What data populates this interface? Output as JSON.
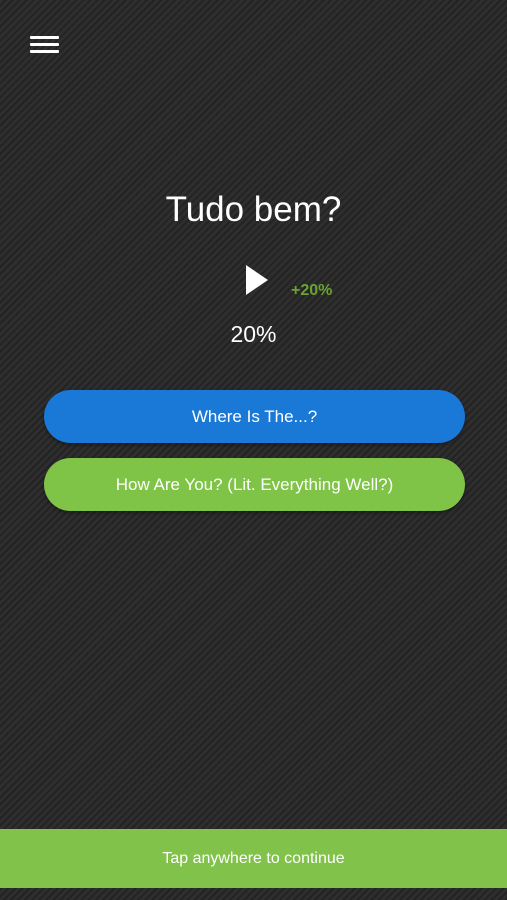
{
  "header": {
    "menu_icon": "hamburger-menu-icon"
  },
  "question": {
    "phrase": "Tudo bem?",
    "play_icon": "play-icon",
    "bonus": "+20%",
    "progress": "20%"
  },
  "answers": [
    {
      "label": "Where Is The...?",
      "color": "#1a78d7"
    },
    {
      "label": "How Are You? (Lit. Everything Well?)",
      "color": "#7fc347"
    }
  ],
  "footer": {
    "continue_label": "Tap anywhere to continue",
    "color": "#81c24a"
  },
  "colors": {
    "background": "#2b2b2b",
    "bonus_text": "#6aa32f"
  }
}
